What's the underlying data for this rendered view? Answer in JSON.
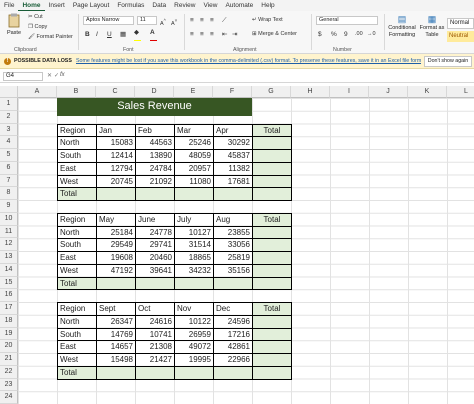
{
  "menu": {
    "tabs": [
      "File",
      "Home",
      "Insert",
      "Page Layout",
      "Formulas",
      "Data",
      "Review",
      "View",
      "Automate",
      "Help"
    ],
    "active": "Home"
  },
  "ribbon": {
    "paste": "Paste",
    "cut": "Cut",
    "copy": "Copy",
    "format_painter": "Format Painter",
    "clipboard": "Clipboard",
    "font_name": "Aptos Narrow",
    "font_size": "11",
    "font_group": "Font",
    "bold": "B",
    "italic": "I",
    "underline": "U",
    "font_color": "A",
    "fill_color": "#ffff00",
    "wrap_text": "Wrap Text",
    "merge_center": "Merge & Center",
    "alignment_group": "Alignment",
    "number_format": "General",
    "currency": "$",
    "percent": "%",
    "comma": "9",
    "dec_inc": ".00",
    "dec_dec": "→0",
    "number_group": "Number",
    "conditional_formatting": "Conditional Formatting",
    "format_as_table": "Format as Table",
    "style_normal": "Normal",
    "style_neutral": "Neutral"
  },
  "warning": {
    "title": "POSSIBLE DATA LOSS",
    "message": "Some features might be lost if you save this workbook in the comma-delimited (.csv) format. To preserve these features, save it in an Excel file format.",
    "dismiss": "Don't show again"
  },
  "formula_bar": {
    "cell_ref": "G4",
    "fx": "fx",
    "cancel": "✕",
    "enter": "✓",
    "value": ""
  },
  "columns": [
    "A",
    "B",
    "C",
    "D",
    "E",
    "F",
    "G",
    "H",
    "I",
    "J",
    "K",
    "L"
  ],
  "rows": [
    "1",
    "2",
    "3",
    "4",
    "5",
    "6",
    "7",
    "8",
    "9",
    "10",
    "11",
    "12",
    "13",
    "14",
    "15",
    "16",
    "17",
    "18",
    "19",
    "20",
    "21",
    "22",
    "23",
    "24"
  ],
  "sheet": {
    "title": "Sales Revenue",
    "title_color": "#375623",
    "total_fill": "#e2efda",
    "blocks": [
      {
        "header": [
          "Region",
          "Jan",
          "Feb",
          "Mar",
          "Apr",
          "Total"
        ],
        "rows": [
          [
            "North",
            "15083",
            "44563",
            "25246",
            "30292",
            ""
          ],
          [
            "South",
            "12414",
            "13890",
            "48059",
            "45837",
            ""
          ],
          [
            "East",
            "12794",
            "24784",
            "20957",
            "11382",
            ""
          ],
          [
            "West",
            "20745",
            "21092",
            "11080",
            "17681",
            ""
          ]
        ],
        "total_label": "Total"
      },
      {
        "header": [
          "Region",
          "May",
          "June",
          "July",
          "Aug",
          "Total"
        ],
        "rows": [
          [
            "North",
            "25184",
            "24778",
            "10127",
            "23855",
            ""
          ],
          [
            "South",
            "29549",
            "29741",
            "31514",
            "33056",
            ""
          ],
          [
            "East",
            "19608",
            "20460",
            "18865",
            "25819",
            ""
          ],
          [
            "West",
            "47192",
            "39641",
            "34232",
            "35156",
            ""
          ]
        ],
        "total_label": "Total"
      },
      {
        "header": [
          "Region",
          "Sept",
          "Oct",
          "Nov",
          "Dec",
          "Total"
        ],
        "rows": [
          [
            "North",
            "26347",
            "24616",
            "10122",
            "24596",
            ""
          ],
          [
            "South",
            "14769",
            "10741",
            "26959",
            "17216",
            ""
          ],
          [
            "East",
            "14657",
            "21308",
            "49072",
            "42861",
            ""
          ],
          [
            "West",
            "15498",
            "21427",
            "19995",
            "22966",
            ""
          ]
        ],
        "total_label": "Total"
      }
    ]
  }
}
